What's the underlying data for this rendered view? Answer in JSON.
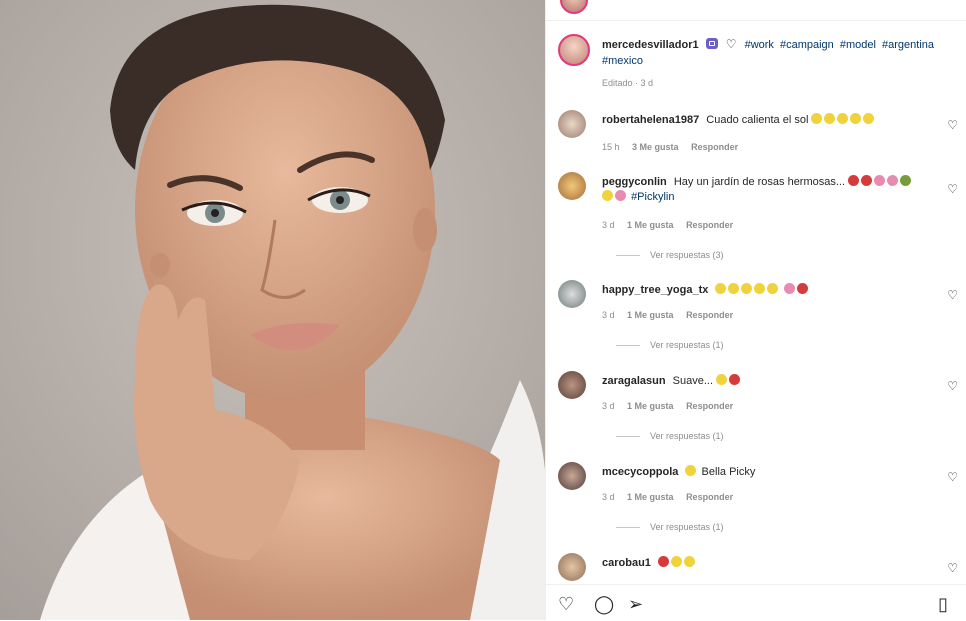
{
  "post": {
    "author": "mercedesvillador1",
    "hashtags": [
      "#work",
      "#campaign",
      "#model",
      "#argentina",
      "#mexico"
    ],
    "edited": "Editado · 3 d"
  },
  "comments": [
    {
      "user": "robertahelena1987",
      "text": "Cuado calienta el sol",
      "emojis": [
        "yellow",
        "yellow",
        "yellow",
        "yellow",
        "yellow"
      ],
      "time": "15 h",
      "likes": "3 Me gusta",
      "reply": "Responder",
      "replies": null
    },
    {
      "user": "peggyconlin",
      "text": "Hay un jardín de rosas hermosas...",
      "emojis": [
        "red",
        "red",
        "pink",
        "pink",
        "green",
        "yellow",
        "pink"
      ],
      "tag": "#Pickylin",
      "time": "3 d",
      "likes": "1 Me gusta",
      "reply": "Responder",
      "replies": "Ver respuestas (3)"
    },
    {
      "user": "happy_tree_yoga_tx",
      "text": "",
      "emojis": [
        "yellow",
        "yellow",
        "yellow",
        "yellow",
        "yellow",
        "pink",
        "red"
      ],
      "time": "3 d",
      "likes": "1 Me gusta",
      "reply": "Responder",
      "replies": "Ver respuestas (1)"
    },
    {
      "user": "zaragalasun",
      "text": "Suave...",
      "emojis": [
        "yellow",
        "red"
      ],
      "time": "3 d",
      "likes": "1 Me gusta",
      "reply": "Responder",
      "replies": "Ver respuestas (1)"
    },
    {
      "user": "mcecycoppola",
      "text": "Bella Picky",
      "emojis": [
        "yellow"
      ],
      "time": "3 d",
      "likes": "1 Me gusta",
      "reply": "Responder",
      "replies": "Ver respuestas (1)"
    },
    {
      "user": "carobau1",
      "text": "",
      "emojis": [
        "red",
        "yellow",
        "yellow"
      ],
      "time": "",
      "likes": "",
      "reply": "",
      "replies": null
    }
  ],
  "actions": {
    "like_icon": "heart-outline",
    "comment_icon": "comment-bubble",
    "share_icon": "paper-plane",
    "save_icon": "bookmark"
  }
}
